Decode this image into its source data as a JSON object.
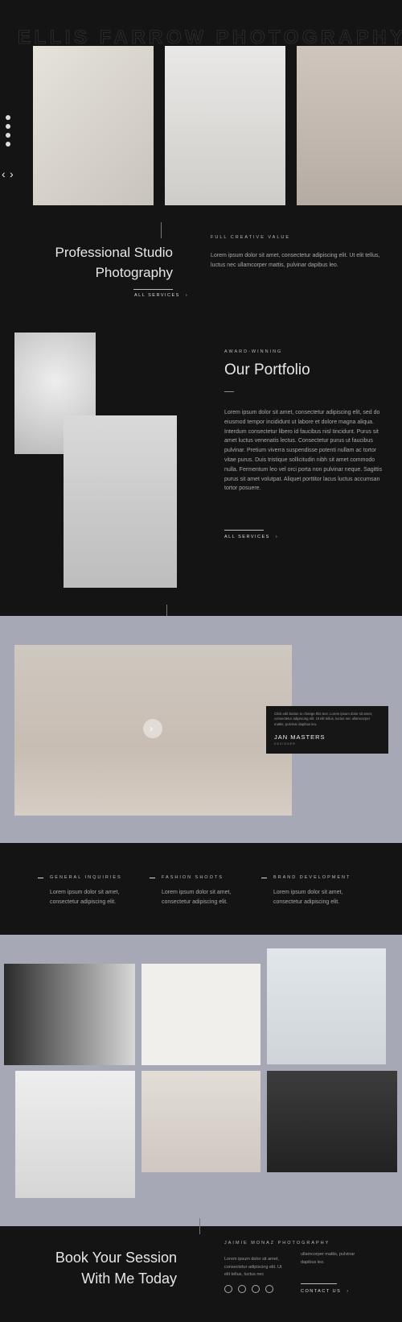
{
  "brand": {
    "wordmark": "ELLIS FARROW PHOTOGRAPHY"
  },
  "social": {
    "icons": [
      "facebook-icon",
      "twitter-icon",
      "youtube-icon",
      "pinterest-icon"
    ]
  },
  "slider": {
    "prev": "‹",
    "next": "›"
  },
  "intro": {
    "eyebrow": "FULL CREATIVE VALUE",
    "title_line1": "Professional Studio",
    "title_line2": "Photography",
    "body": "Lorem ipsum dolor sit amet, consectetur adipiscing elit. Ut elit tellus, luctus nec ullamcorper mattis, pulvinar dapibus leo.",
    "link": "ALL SERVICES"
  },
  "portfolio": {
    "eyebrow": "AWARD-WINNING",
    "title": "Our Portfolio",
    "body": "Lorem ipsum dolor sit amet, consectetur adipiscing elit, sed do eiusmod tempor incididunt ut labore et dolore magna aliqua. Interdum consectetur libero id faucibus nisl tincidunt. Purus sit amet luctus venenatis lectus. Consectetur purus ut faucibus pulvinar. Pretium viverra suspendisse potenti nullam ac tortor vitae purus. Duis tristique sollicitudin nibh sit amet commodo nulla. Fermentum leo vel orci porta non pulvinar neque. Sagittis purus sit amet volutpat. Aliquet porttitor lacus luctus accumsan tortor posuere.",
    "link": "ALL SERVICES"
  },
  "testimonial": {
    "text": "Click edit button to change this text. Lorem ipsum dolor sit amet, consectetur adipiscing elit. Ut elit tellus, luctus nec ullamcorper mattis, pulvinar dapibus leo.",
    "name": "JAN MASTERS",
    "role": "DESIGNER"
  },
  "services": [
    {
      "title": "GENERAL INQUIRIES",
      "body": "Lorem ipsum dolor sit amet, consectetur adipiscing elit."
    },
    {
      "title": "FASHION SHOOTS",
      "body": "Lorem ipsum dolor sit amet, consectetur adipiscing elit."
    },
    {
      "title": "BRAND DEVELOPMENT",
      "body": "Lorem ipsum dolor sit amet, consectetur adipiscing elit."
    }
  ],
  "footer": {
    "title_line1": "Book Your Session",
    "title_line2": "With Me Today",
    "eyebrow": "JAIMIE MONAZ PHOTOGRAPHY",
    "col1": "Lorem ipsum dolor sit amet, consectetur adipiscing elit. Ut elit tellus, luctus nec",
    "col2": "ullamcorper mattis, pulvinar dapibus leo.",
    "link": "CONTACT US",
    "icons": [
      "facebook-icon",
      "instagram-icon",
      "youtube-icon",
      "snapchat-icon"
    ]
  },
  "colors": {
    "dark": "#141414",
    "slate": "#a6a8b5",
    "text": "#dddddd"
  }
}
